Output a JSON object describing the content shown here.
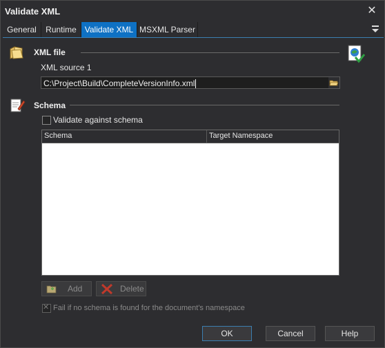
{
  "window": {
    "title": "Validate XML"
  },
  "tabs": [
    {
      "label": "General"
    },
    {
      "label": "Runtime"
    },
    {
      "label": "Validate XML"
    },
    {
      "label": "MSXML Parser"
    }
  ],
  "xml_file": {
    "section_title": "XML file",
    "source_label": "XML source 1",
    "source_value": "C:\\Project\\Build\\CompleteVersionInfo.xml"
  },
  "schema": {
    "section_title": "Schema",
    "validate_label": "Validate against schema",
    "validate_checked": false,
    "columns": [
      "Schema",
      "Target Namespace"
    ],
    "add_label": "Add",
    "delete_label": "Delete",
    "fail_label": "Fail if no schema is found for the document's namespace",
    "fail_checked": true
  },
  "footer": {
    "ok_label": "OK",
    "cancel_label": "Cancel",
    "help_label": "Help"
  },
  "colors": {
    "accent": "#0e71c4",
    "background": "#2d2d30"
  }
}
